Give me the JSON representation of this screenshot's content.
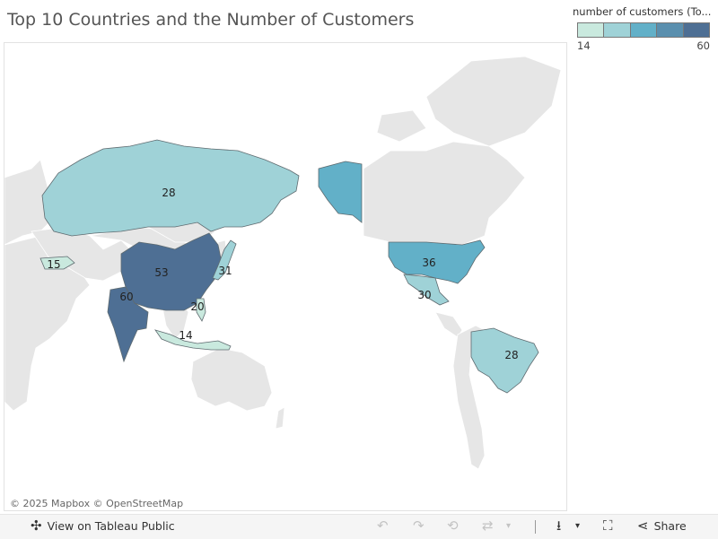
{
  "title": "Top 10 Countries and the Number of Customers",
  "legend": {
    "title": "number of customers (To...",
    "min_label": "14",
    "max_label": "60",
    "steps": [
      "#c9e9de",
      "#9fd2d7",
      "#62b0c8",
      "#5a8fae",
      "#4e6f94"
    ]
  },
  "attribution": "© 2025 Mapbox  © OpenStreetMap",
  "colors": {
    "land": "#e6e6e6",
    "water": "#ffffff",
    "border": "#ffffff"
  },
  "map_data": {
    "type": "choropleth",
    "measure": "number of customers",
    "values": [
      {
        "country": "India",
        "value": 60
      },
      {
        "country": "China",
        "value": 53
      },
      {
        "country": "United States",
        "value": 36
      },
      {
        "country": "Japan",
        "value": 31
      },
      {
        "country": "Mexico",
        "value": 30
      },
      {
        "country": "Russia",
        "value": 28
      },
      {
        "country": "Brazil",
        "value": 28
      },
      {
        "country": "Philippines",
        "value": 20
      },
      {
        "country": "Turkey",
        "value": 15
      },
      {
        "country": "Indonesia",
        "value": 14
      }
    ]
  },
  "toolbar": {
    "view_label": "View on Tableau Public",
    "share_label": "Share"
  }
}
